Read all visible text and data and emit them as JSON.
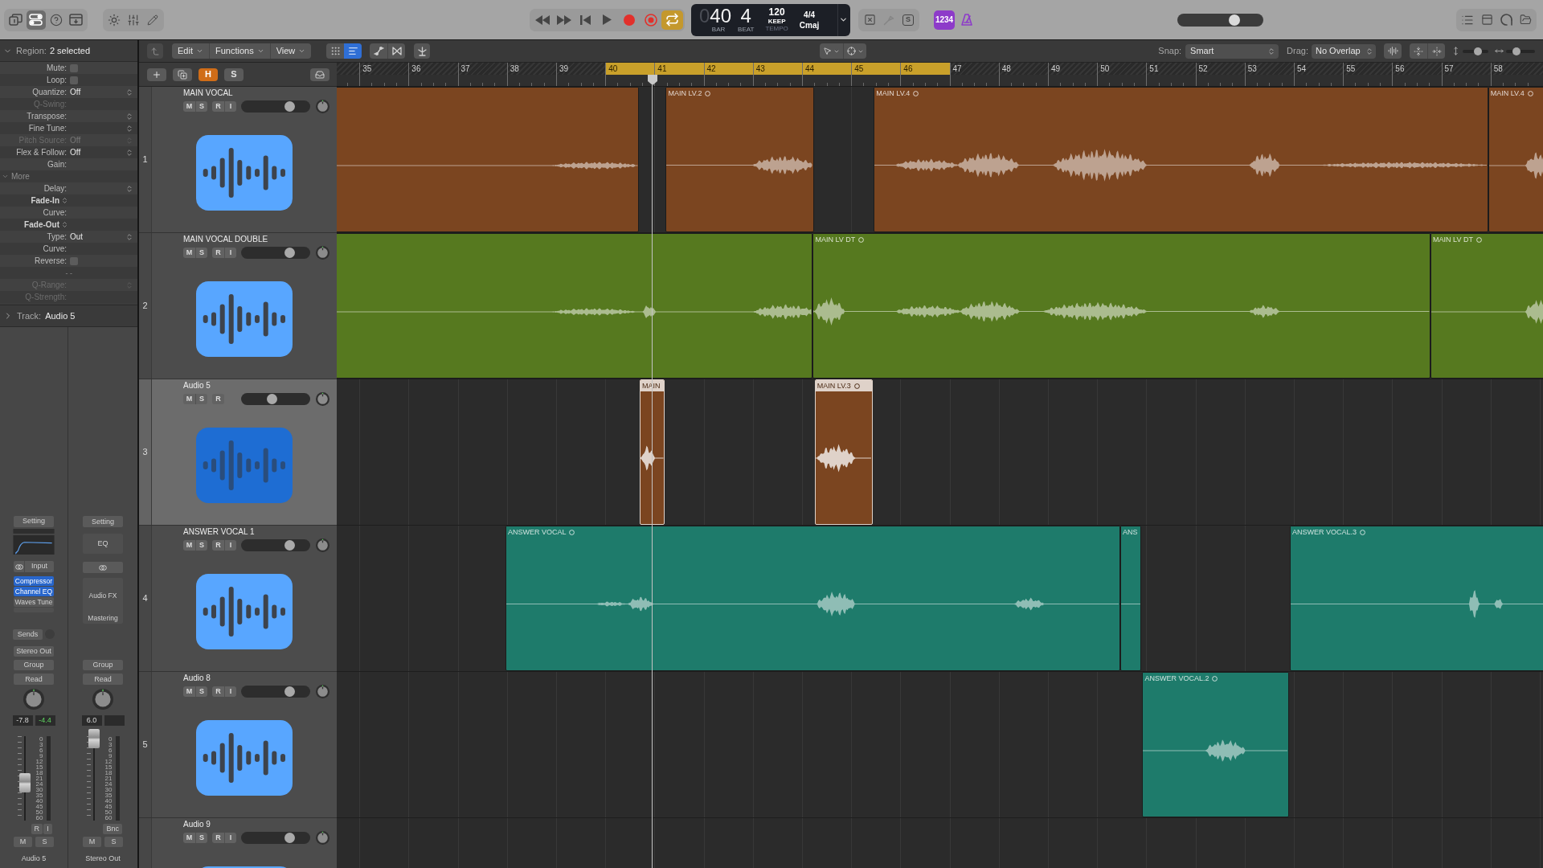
{
  "toolbar": {
    "view_buttons": [
      {
        "kind": "library",
        "selected": false
      },
      {
        "kind": "inspector",
        "selected": true
      },
      {
        "kind": "help",
        "selected": false
      },
      {
        "kind": "toolbar",
        "selected": false
      }
    ],
    "transport": [
      {
        "kind": "rewind",
        "on": false
      },
      {
        "kind": "forward",
        "on": false
      },
      {
        "kind": "to_start",
        "on": false
      },
      {
        "kind": "play",
        "on": false
      },
      {
        "kind": "record",
        "on": false
      },
      {
        "kind": "capture",
        "on": false
      },
      {
        "kind": "cycle",
        "on": true
      }
    ],
    "lcd": {
      "bar_lead": "0",
      "bar": "40",
      "bar_caption": "BAR",
      "beat": "4",
      "beat_caption": "BEAT",
      "tempo": "120",
      "tempo_mode": "KEEP",
      "tempo_caption": "TEMPO",
      "signature": "4/4",
      "key": "Cmaj"
    },
    "mode_buttons": [
      {
        "kind": "replace",
        "disabled": false
      },
      {
        "kind": "tuner",
        "disabled": true
      },
      {
        "kind": "solo",
        "label": "S",
        "disabled": false
      }
    ],
    "count_in": {
      "label": "1234",
      "on": true
    },
    "metronome": {
      "on": true
    },
    "master_volume": {
      "level": 0.66
    }
  },
  "inspector": {
    "region": {
      "label": "Region:",
      "value": "2 selected",
      "expanded": true
    },
    "rows": [
      {
        "kind": "checkbox",
        "label": "Mute:",
        "checked": false
      },
      {
        "kind": "checkbox",
        "label": "Loop:",
        "checked": false
      },
      {
        "kind": "field",
        "label": "Quantize:",
        "value": "Off",
        "stepper": true,
        "disabled": false
      },
      {
        "kind": "field",
        "label": "Q-Swing:",
        "stepper": false,
        "disabled": true
      },
      {
        "kind": "field",
        "label": "Transpose:",
        "stepper": true,
        "disabled": false
      },
      {
        "kind": "field",
        "label": "Fine Tune:",
        "stepper": true,
        "disabled": false
      },
      {
        "kind": "field",
        "label": "Pitch Source:",
        "value": "Off",
        "stepper": true,
        "disabled": true
      },
      {
        "kind": "field",
        "label": "Flex & Follow:",
        "value": "Off",
        "stepper": true,
        "disabled": false
      },
      {
        "kind": "field",
        "label": "Gain:",
        "stepper": false,
        "disabled": false
      },
      {
        "kind": "section",
        "label": "More",
        "expanded": true
      },
      {
        "kind": "field",
        "label": "Delay:",
        "stepper": true,
        "disabled": false
      },
      {
        "kind": "popup",
        "label": "Fade-In"
      },
      {
        "kind": "field",
        "label": "Curve:",
        "stepper": false,
        "disabled": false
      },
      {
        "kind": "popup",
        "label": "Fade-Out"
      },
      {
        "kind": "field",
        "label": "Type:",
        "value": "Out",
        "stepper": true,
        "disabled": false
      },
      {
        "kind": "field",
        "label": "Curve:",
        "stepper": false,
        "disabled": false
      },
      {
        "kind": "checkbox",
        "label": "Reverse:",
        "checked": false
      },
      {
        "kind": "note",
        "label": "- -"
      },
      {
        "kind": "field",
        "label": "Q-Range:",
        "stepper": true,
        "disabled": true
      },
      {
        "kind": "field",
        "label": "Q-Strength:",
        "stepper": false,
        "disabled": true
      }
    ],
    "track": {
      "label": "Track:",
      "value": "Audio 5",
      "expanded": false
    }
  },
  "channel_strips": [
    {
      "kind": "audio",
      "setting": "Setting",
      "input": "Input",
      "plugins": [
        {
          "name": "Compressor",
          "on": true
        },
        {
          "name": "Channel EQ",
          "on": true
        },
        {
          "name": "Waves Tune",
          "on": false
        }
      ],
      "sends": "Sends",
      "output": "Stereo Out",
      "group": "Group",
      "automation": "Read",
      "volume_reading": "-7.8",
      "peak_reading": "-4.4",
      "fader": {
        "level": 0.45
      },
      "meter_scale": [
        "0",
        "3",
        "6",
        "9",
        "12",
        "15",
        "18",
        "21",
        "24",
        "30",
        "35",
        "40",
        "45",
        "50",
        "60"
      ],
      "upper_buttons": [
        "R",
        "I"
      ],
      "lower_buttons": [
        "M",
        "S"
      ],
      "name": "Audio 5"
    },
    {
      "kind": "output",
      "setting": "Setting",
      "eq_label": "EQ",
      "audio_fx": "Audio FX",
      "audio_fx_preset": "Mastering",
      "group": "Group",
      "automation": "Read",
      "volume_reading": "6.0",
      "fader": {
        "level": 0.97
      },
      "meter_scale": [
        "0",
        "3",
        "6",
        "9",
        "12",
        "15",
        "18",
        "21",
        "24",
        "30",
        "35",
        "40",
        "45",
        "50",
        "60"
      ],
      "upper_buttons": [
        "Bnc"
      ],
      "lower_buttons": [
        "M",
        "S"
      ],
      "name": "Stereo Out"
    }
  ],
  "arrange_toolbar": {
    "menus": [
      "Edit",
      "Functions",
      "View"
    ],
    "view_toggle": [
      {
        "kind": "grid",
        "selected": false
      },
      {
        "kind": "list",
        "selected": true
      }
    ],
    "snap": {
      "label": "Snap:",
      "value": "Smart"
    },
    "drag": {
      "label": "Drag:",
      "value": "No Overlap"
    },
    "vertical_zoom": {
      "level": 0.6
    },
    "horizontal_zoom": {
      "level": 0.35
    }
  },
  "track_toolbar": {
    "toggles": [
      {
        "label": "H",
        "on": true
      },
      {
        "label": "S",
        "on": false
      }
    ]
  },
  "ruler": {
    "bars": [
      {
        "label": "35",
        "in_cycle": false
      },
      {
        "label": "36",
        "in_cycle": false
      },
      {
        "label": "37",
        "in_cycle": false
      },
      {
        "label": "38",
        "in_cycle": false
      },
      {
        "label": "39",
        "in_cycle": false
      },
      {
        "label": "40",
        "in_cycle": true
      },
      {
        "label": "41",
        "in_cycle": true
      },
      {
        "label": "42",
        "in_cycle": true
      },
      {
        "label": "43",
        "in_cycle": true
      },
      {
        "label": "44",
        "in_cycle": true
      },
      {
        "label": "45",
        "in_cycle": true
      },
      {
        "label": "46",
        "in_cycle": true
      },
      {
        "label": "47",
        "in_cycle": false
      },
      {
        "label": "48",
        "in_cycle": false
      },
      {
        "label": "49",
        "in_cycle": false
      },
      {
        "label": "50",
        "in_cycle": false
      },
      {
        "label": "51",
        "in_cycle": false
      },
      {
        "label": "52",
        "in_cycle": false
      },
      {
        "label": "53",
        "in_cycle": false
      },
      {
        "label": "54",
        "in_cycle": false
      },
      {
        "label": "55",
        "in_cycle": false
      },
      {
        "label": "56",
        "in_cycle": false
      },
      {
        "label": "57",
        "in_cycle": false
      },
      {
        "label": "58",
        "in_cycle": false
      }
    ]
  },
  "tracks": [
    {
      "number": "1",
      "name": "MAIN VOCAL",
      "selected": false,
      "buttons": [
        "M",
        "S",
        "R",
        "I"
      ],
      "volume": {
        "level": 0.7
      },
      "regions": [
        {
          "color": "#7b4520",
          "selected": false
        },
        {
          "label": "MAIN LV.2",
          "ring": true,
          "color": "#7b4520",
          "selected": false
        },
        {
          "label": "MAIN LV.4",
          "ring": true,
          "color": "#7b4520",
          "selected": false
        },
        {
          "label": "MAIN LV.4",
          "ring": true,
          "color": "#7b4520",
          "selected": false
        }
      ]
    },
    {
      "number": "2",
      "name": "MAIN VOCAL DOUBLE",
      "selected": false,
      "buttons": [
        "M",
        "S",
        "R",
        "I"
      ],
      "volume": {
        "level": 0.7
      },
      "regions": [
        {
          "color": "#56791f",
          "selected": false
        },
        {
          "label": "MAIN LV DT",
          "ring": true,
          "color": "#56791f",
          "selected": false
        },
        {
          "label": "MAIN LV DT",
          "ring": true,
          "color": "#56791f",
          "selected": false
        }
      ]
    },
    {
      "number": "3",
      "name": "Audio 5",
      "selected": true,
      "buttons": [
        "M",
        "S",
        "R"
      ],
      "volume": {
        "level": 0.45
      },
      "regions": [
        {
          "label": "MAIN",
          "ring": false,
          "color": "#7b4520",
          "selected": true
        },
        {
          "label": "MAIN LV.3",
          "ring": true,
          "color": "#7b4520",
          "selected": true
        }
      ]
    },
    {
      "number": "4",
      "name": "ANSWER VOCAL 1",
      "selected": false,
      "buttons": [
        "M",
        "S",
        "R",
        "I"
      ],
      "volume": {
        "level": 0.7
      },
      "regions": [
        {
          "label": "ANSWER VOCAL",
          "ring": true,
          "color": "#1e7b6b",
          "selected": false
        },
        {
          "label": "ANS",
          "ring": false,
          "color": "#1e7b6b",
          "selected": false
        },
        {
          "label": "ANSWER VOCAL.3",
          "ring": true,
          "color": "#1e7b6b",
          "selected": false
        }
      ]
    },
    {
      "number": "5",
      "name": "Audio 8",
      "selected": false,
      "buttons": [
        "M",
        "S",
        "R",
        "I"
      ],
      "volume": {
        "level": 0.7
      },
      "regions": [
        {
          "label": "ANSWER VOCAL.2",
          "ring": true,
          "color": "#1e7b6b",
          "selected": false
        }
      ]
    },
    {
      "name": "Audio 9",
      "selected": false,
      "buttons": [
        "M",
        "S",
        "R",
        "I"
      ],
      "volume": {
        "level": 0.7
      }
    }
  ]
}
